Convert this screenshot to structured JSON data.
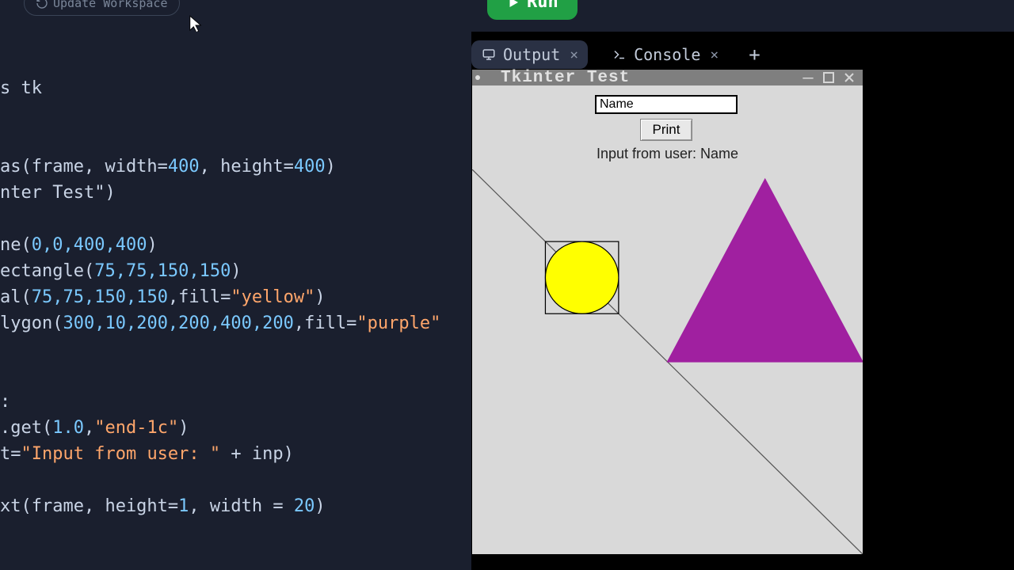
{
  "toolbar": {
    "update_label": "Update Workspace",
    "run_label": "Run"
  },
  "tabs": {
    "output": "Output",
    "console": "Console"
  },
  "tk": {
    "title": "Tkinter Test",
    "input_value": "Name",
    "print_label": "Print",
    "status_label": "Input from user: Name"
  },
  "code": {
    "l1": "s tk",
    "l2a": "as(frame, width=",
    "l2b": "400",
    "l2c": ", height=",
    "l2d": "400",
    "l2e": ")",
    "l3a": "nter Test\")",
    "l4a": "ne(",
    "l4vals": "0,0,400,400",
    "l4b": ")",
    "l5a": "ectangle(",
    "l5vals": "75,75,150,150",
    "l5b": ")",
    "l6a": "al(",
    "l6vals": "75,75,150,150",
    "l6b": ",fill=",
    "l6str": "\"yellow\"",
    "l6c": ")",
    "l7a": "lygon(",
    "l7vals": "300,10,200,200,400,200",
    "l7b": ",fill=",
    "l7str": "\"purple\"",
    "l8": ":",
    "l9a": ".get(",
    "l9n1": "1.0",
    "l9c": ",",
    "l9str": "\"end-1c\"",
    "l9b": ")",
    "l10a": "t=",
    "l10str": "\"Input from user: \"",
    "l10b": " + inp)",
    "l11a": "xt(frame, height=",
    "l11n1": "1",
    "l11b": ", width = ",
    "l11n2": "20",
    "l11c": ")"
  }
}
